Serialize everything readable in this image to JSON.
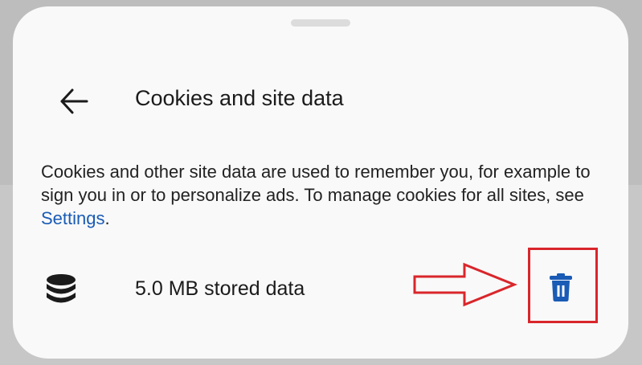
{
  "sheet": {
    "title": "Cookies and site data",
    "description": {
      "text_before_link": "Cookies and other site data are used to remember you, for example to sign you in or to personalize ads. To manage cookies for all sites, see ",
      "link_label": "Settings",
      "text_after_link": "."
    },
    "storage": {
      "label": "5.0 MB stored data"
    }
  },
  "colors": {
    "link": "#1a5bb5",
    "delete_icon": "#1a5bb5",
    "annotation": "#d9262b"
  },
  "icons": {
    "back": "arrow-left-icon",
    "storage": "database-icon",
    "delete": "trash-icon"
  }
}
